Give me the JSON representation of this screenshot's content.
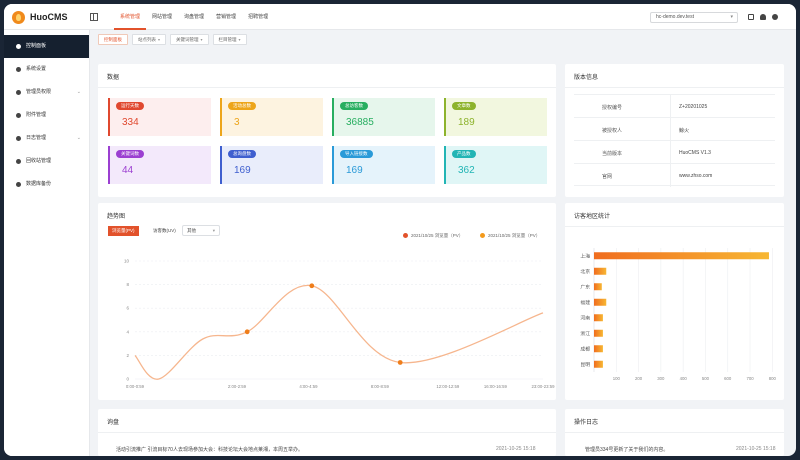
{
  "app": {
    "name": "HuoCMS"
  },
  "topnav": [
    "系统管理",
    "网站管理",
    "询盘管理",
    "营销管理",
    "招聘管理"
  ],
  "domain": "hc-demo.dev.test",
  "sidebar": {
    "items": [
      {
        "label": "控制面板",
        "icon": "dashboard-icon",
        "arrow": ""
      },
      {
        "label": "系统设置",
        "icon": "gear-icon",
        "arrow": ""
      },
      {
        "label": "管理员权限",
        "icon": "user-icon",
        "arrow": "⌄"
      },
      {
        "label": "附件管理",
        "icon": "attachment-icon",
        "arrow": ""
      },
      {
        "label": "日志管理",
        "icon": "log-icon",
        "arrow": "⌄"
      },
      {
        "label": "回收站管理",
        "icon": "trash-icon",
        "arrow": ""
      },
      {
        "label": "数据库备份",
        "icon": "database-icon",
        "arrow": ""
      }
    ]
  },
  "tags": [
    {
      "label": "控制面板",
      "drop": ""
    },
    {
      "label": "站点列表",
      "drop": "▾"
    },
    {
      "label": "关键词管理",
      "drop": "▾"
    },
    {
      "label": "栏目管理",
      "drop": "▾"
    }
  ],
  "stats": {
    "title": "数据",
    "items": [
      {
        "label": "运行天数",
        "value": "334",
        "color": "#e0482f",
        "bg": "#fdeeee"
      },
      {
        "label": "活动总数",
        "value": "3",
        "color": "#eda51a",
        "bg": "#fdf3e0"
      },
      {
        "label": "总访客数",
        "value": "36885",
        "color": "#27ae60",
        "bg": "#e6f6ec"
      },
      {
        "label": "文章数",
        "value": "189",
        "color": "#8db32c",
        "bg": "#f2f7df"
      },
      {
        "label": "关键词数",
        "value": "44",
        "color": "#9b3fd1",
        "bg": "#f3e9fb"
      },
      {
        "label": "总询盘数",
        "value": "169",
        "color": "#3f5fcf",
        "bg": "#e9edfb"
      },
      {
        "label": "导入链接数",
        "value": "169",
        "color": "#2a9ad8",
        "bg": "#e5f3fb"
      },
      {
        "label": "产品数",
        "value": "362",
        "color": "#22b5b5",
        "bg": "#e0f6f6"
      }
    ]
  },
  "version": {
    "title": "版本信息",
    "rows": [
      {
        "label": "授权编号",
        "value": "Z+20201025"
      },
      {
        "label": "被授权人",
        "value": "鲸火"
      },
      {
        "label": "当前版本",
        "value": "HuoCMS V1.3"
      },
      {
        "label": "官网",
        "value": "www.zhso.com"
      }
    ]
  },
  "trend": {
    "title": "趋势图",
    "tabs": [
      "浏览量(PV)",
      "访客数(UV)"
    ],
    "select": "其他",
    "legend": [
      "2021/10/25 浏览量（PV）",
      "2021/10/25 浏览量（PV）"
    ],
    "colors": [
      "#e2522b",
      "#f39a1c"
    ]
  },
  "region": {
    "title": "访客地区统计"
  },
  "inquiry": {
    "title": "询盘",
    "row": {
      "text": "活动引流推广  引流目标70人去现场参加大会：科技论坛大会地点莱湘，本周五举办。",
      "time": "2021-10-25 15:18"
    }
  },
  "oplog": {
    "title": "操作日志",
    "row": {
      "text": "管理员334号更新了关于我们的内容。",
      "time": "2021-10-25 15:18"
    }
  },
  "chart_data": [
    {
      "type": "line",
      "x": [
        "0:00-0:59",
        "2:00-2:59",
        "4:00-4:59",
        "8:00-8:59",
        "12:00-12:59",
        "16:00-16:59",
        "23:00-23:59"
      ],
      "x_ticks": [
        "0:00-0:59",
        "2:00-2:59",
        "4:00-4:59",
        "8:00-8:59",
        "12:00-12:59",
        "16:00-16:59",
        "23:00-23:59"
      ],
      "ylim": [
        0,
        10
      ],
      "y_ticks": [
        0,
        2,
        4,
        6,
        8,
        10
      ],
      "points": [
        {
          "x": 0,
          "y": 2
        },
        {
          "x": 0.7,
          "y": 0
        },
        {
          "x": 2,
          "y": 3.4
        },
        {
          "x": 3.3,
          "y": 4
        },
        {
          "x": 5.2,
          "y": 7.9
        },
        {
          "x": 7.8,
          "y": 1.4
        },
        {
          "x": 12,
          "y": 5.6
        }
      ],
      "markers": [
        {
          "x": 3.3,
          "y": 4
        },
        {
          "x": 5.2,
          "y": 7.9
        },
        {
          "x": 7.8,
          "y": 1.4
        }
      ],
      "grid": true
    },
    {
      "type": "bar",
      "orientation": "horizontal",
      "categories": [
        "上海",
        "北京",
        "广东",
        "福建",
        "河南",
        "浙江",
        "成都",
        "昆明"
      ],
      "values": [
        785,
        55,
        35,
        55,
        40,
        40,
        40,
        40
      ],
      "x_ticks": [
        100,
        200,
        300,
        400,
        500,
        600,
        700,
        800
      ],
      "xlim": [
        0,
        830
      ],
      "color_start": "#f7b733",
      "color_end": "#f06d1f"
    }
  ]
}
